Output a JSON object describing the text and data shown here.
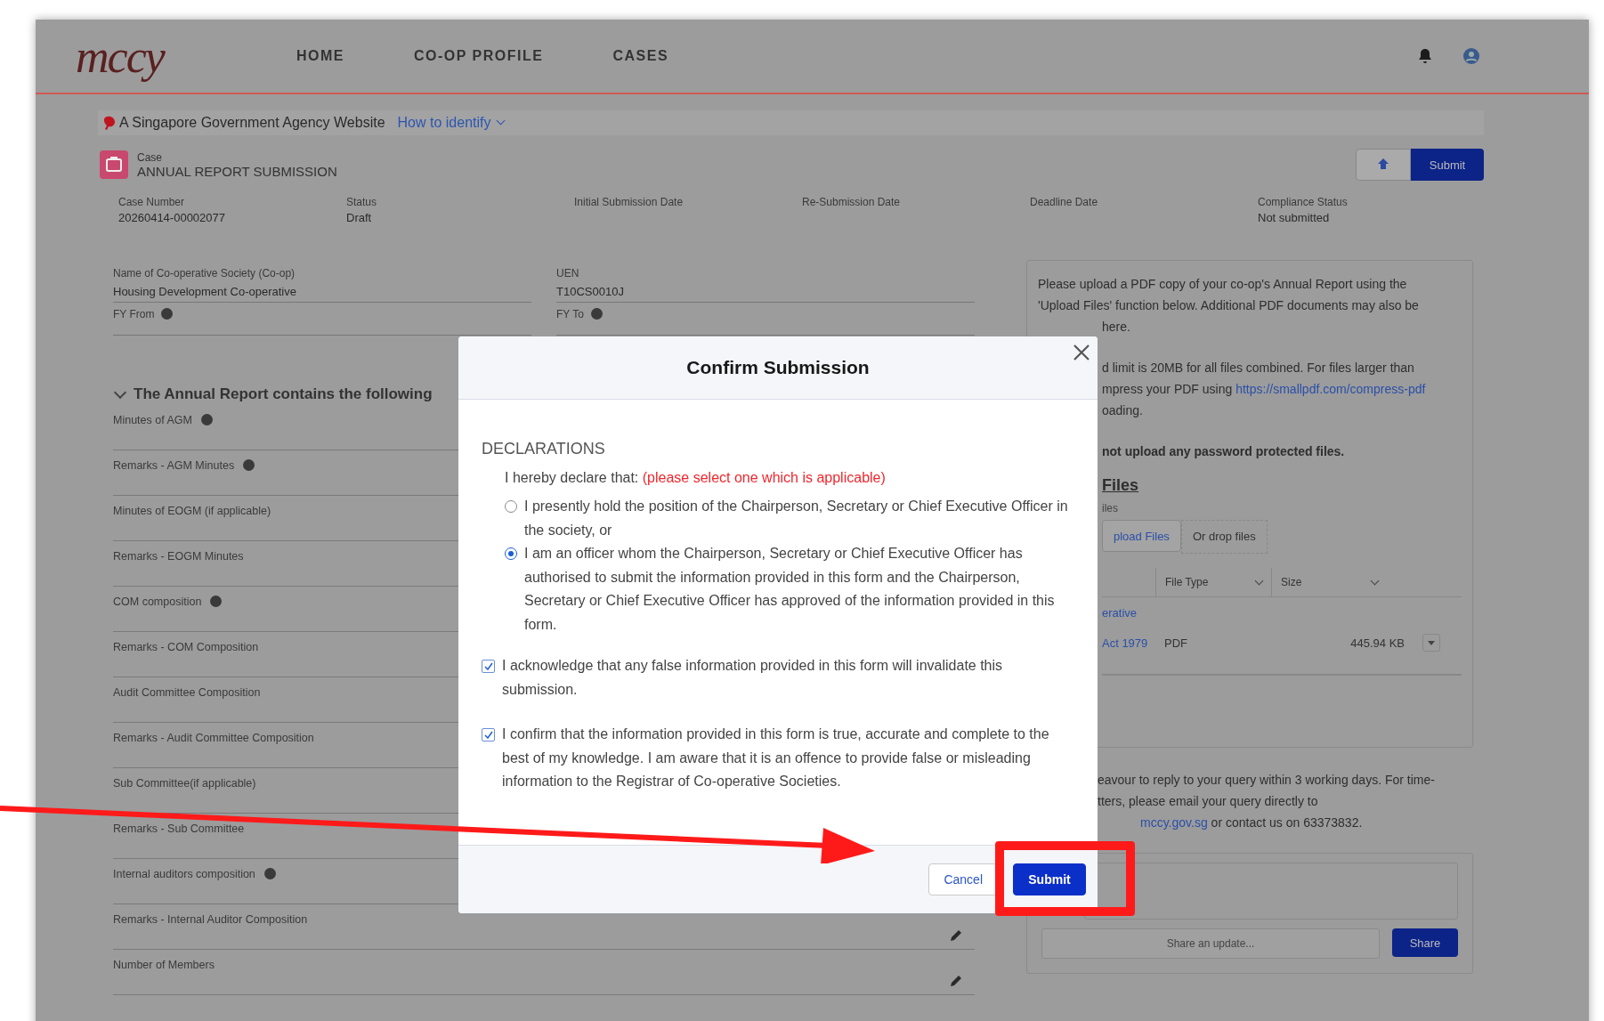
{
  "logo": "mccy",
  "nav": [
    {
      "label": "HOME"
    },
    {
      "label": "CO-OP PROFILE"
    },
    {
      "label": "CASES"
    }
  ],
  "gov_banner": {
    "text": "A Singapore Government Agency Website",
    "link": "How to identify"
  },
  "case": {
    "type": "Case",
    "title": "ANNUAL REPORT SUBMISSION",
    "submit": "Submit"
  },
  "case_fields": [
    {
      "label": "Case Number",
      "value": "20260414-00002077"
    },
    {
      "label": "Status",
      "value": "Draft"
    },
    {
      "label": "Initial Submission Date"
    },
    {
      "label": "Re-Submission Date"
    },
    {
      "label": "Deadline Date"
    },
    {
      "label": "Compliance Status",
      "value": "Not submitted"
    }
  ],
  "form_fields": [
    {
      "label": "Name of Co-operative Society (Co-op)",
      "value": "Housing Development Co-operative"
    },
    {
      "label": "UEN",
      "value": "T10CS0010J"
    }
  ],
  "fy_fields": [
    {
      "label": "FY From"
    },
    {
      "label": "FY To"
    }
  ],
  "section": {
    "title": "The Annual Report contains the following",
    "expanded": true,
    "items": [
      {
        "label": "Minutes of AGM",
        "info": true
      },
      {
        "label": "Remarks - AGM Minutes",
        "info": true
      },
      {
        "label": "Minutes of EOGM (if applicable)",
        "info": false
      },
      {
        "label": "Remarks - EOGM Minutes",
        "info": false
      },
      {
        "label": "COM composition",
        "info": true
      },
      {
        "label": "Remarks - COM Composition",
        "info": false
      },
      {
        "label": "Audit Committee Composition",
        "info": false
      },
      {
        "label": "Remarks - Audit Committee Composition",
        "info": false
      },
      {
        "label": "Sub Committee(if applicable)",
        "info": false
      },
      {
        "label": "Remarks - Sub Committee",
        "info": false
      },
      {
        "label": "Internal auditors composition",
        "info": true
      },
      {
        "label": "Remarks - Internal Auditor Composition",
        "info": false,
        "editable": true
      },
      {
        "label": "Number of Members",
        "info": false,
        "editable": true
      }
    ]
  },
  "upload_panel": {
    "intro_lines": [
      "Please upload a PDF copy of your co-op's Annual Report using the",
      "'Upload Files' function below. Additional PDF documents may also be"
    ],
    "fragments": [
      "here.",
      "d limit is 20MB for all files combined. For files larger than"
    ],
    "compress_text": "mpress your PDF using",
    "compress_link": "https://smallpdf.com/compress-pdf",
    "after": "oading.",
    "warning": "not upload any password protected files.",
    "files_heading": "Files",
    "files_label": "iles",
    "upload_button": "pload Files",
    "drop_text": "Or drop files",
    "columns": [
      {
        "label": "File Type"
      },
      {
        "label": "Size"
      }
    ],
    "rows": [
      {
        "name": "erative",
        "type": "",
        "size": ""
      },
      {
        "name": "Act 1979",
        "type": "PDF",
        "size": "445.94 KB"
      }
    ]
  },
  "contact": {
    "lines": [
      "eavour to reply to your query within 3 working days. For time-",
      "tters, please email your query directly to"
    ],
    "link": "mccy.gov.sg",
    "tail": "or contact us on 63373832."
  },
  "feed": {
    "placeholder": "Share an update...",
    "button": "Share"
  },
  "modal": {
    "title": "Confirm Submission",
    "section": "DECLARATIONS",
    "intro": "I hereby declare that:",
    "intro_note": "(please select one which is applicable)",
    "options": [
      {
        "text": "I presently hold the position of the Chairperson, Secretary or Chief Executive Officer in the society, or",
        "selected": false
      },
      {
        "text": "I am an officer whom the Chairperson, Secretary or Chief Executive Officer has authorised to submit the information provided in this form and the Chairperson, Secretary or Chief Executive Officer has approved of the information provided in this form.",
        "selected": true
      }
    ],
    "checks": [
      {
        "text": "I acknowledge that any false information provided in this form will invalidate this submission.",
        "checked": true
      },
      {
        "text": "I confirm that the information provided in this form is true, accurate and complete to the best of my knowledge. I am aware that it is an offence to provide false or misleading information to the Registrar of Co-operative Societies.",
        "checked": true
      }
    ],
    "buttons": [
      {
        "label": "Cancel",
        "kind": "neutral"
      },
      {
        "label": "Submit",
        "kind": "brand"
      }
    ]
  },
  "annotations": {
    "arrow": true,
    "highlight_box": true
  }
}
